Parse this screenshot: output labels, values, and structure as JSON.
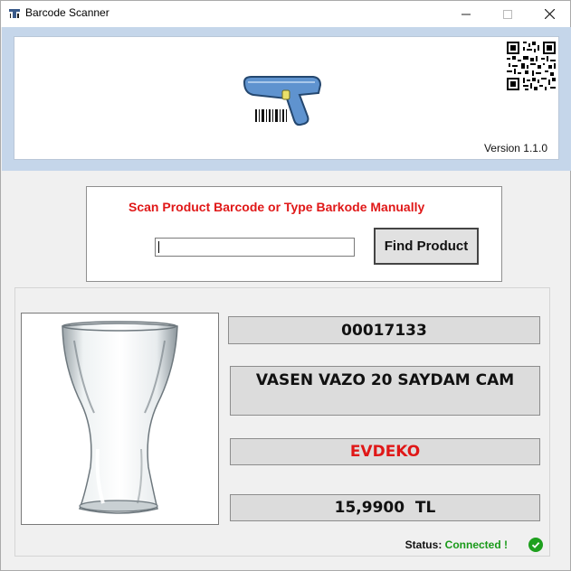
{
  "window": {
    "title": "Barcode Scanner",
    "minimize_icon": "minimize-icon",
    "maximize_icon": "maximize-icon",
    "close_icon": "close-icon"
  },
  "header": {
    "version": "Version 1.1.0",
    "logo_icon": "barcode-scanner-icon",
    "qr_icon": "qr-code-icon"
  },
  "scan": {
    "prompt": "Scan Product Barcode or Type Barkode Manually",
    "input_value": "",
    "find_label": "Find Product"
  },
  "product": {
    "code": "00017133",
    "name": "VASEN VAZO 20 SAYDAM CAM",
    "brand": "EVDEKO",
    "price": "15,9900  TL",
    "image_icon": "glass-vase-image"
  },
  "status": {
    "label": "Status:",
    "value": "Connected !",
    "icon": "check-circle-icon"
  },
  "colors": {
    "header_band": "#c5d6ea",
    "prompt_red": "#e01818",
    "brand_red": "#e01818",
    "status_green": "#1a9a1a",
    "field_gray": "#dcdcdc"
  }
}
